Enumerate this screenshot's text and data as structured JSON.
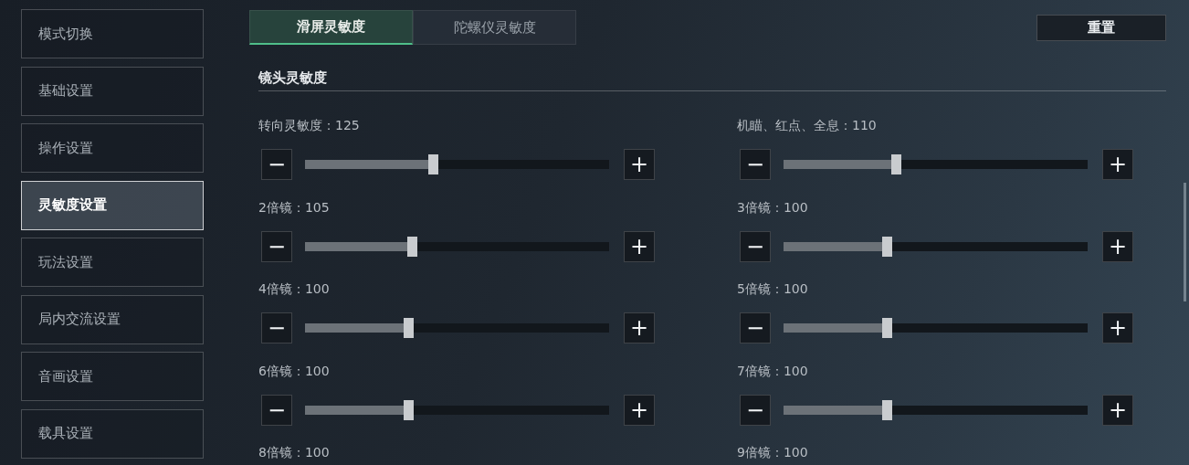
{
  "sidebar": {
    "items": [
      {
        "label": "模式切换",
        "selected": false
      },
      {
        "label": "基础设置",
        "selected": false
      },
      {
        "label": "操作设置",
        "selected": false
      },
      {
        "label": "灵敏度设置",
        "selected": true
      },
      {
        "label": "玩法设置",
        "selected": false
      },
      {
        "label": "局内交流设置",
        "selected": false
      },
      {
        "label": "音画设置",
        "selected": false
      },
      {
        "label": "载具设置",
        "selected": false
      }
    ]
  },
  "tabs": [
    {
      "label": "滑屏灵敏度",
      "selected": true
    },
    {
      "label": "陀螺仪灵敏度",
      "selected": false
    }
  ],
  "reset_button": "重置",
  "section_title": "镜头灵敏度",
  "sliders": [
    {
      "kind": "slider",
      "label": "转向灵敏度：125",
      "level": 0.42,
      "minus": "−",
      "plus": "+"
    },
    {
      "kind": "slider",
      "label": "机瞄、红点、全息：110",
      "level": 0.37,
      "minus": "−",
      "plus": "+"
    },
    {
      "kind": "slider",
      "label": "2倍镜：105",
      "level": 0.35,
      "minus": "−",
      "plus": "+"
    },
    {
      "kind": "slider",
      "label": "3倍镜：100",
      "level": 0.34,
      "minus": "−",
      "plus": "+"
    },
    {
      "kind": "slider",
      "label": "4倍镜：100",
      "level": 0.34,
      "minus": "−",
      "plus": "+"
    },
    {
      "kind": "slider",
      "label": "5倍镜：100",
      "level": 0.34,
      "minus": "−",
      "plus": "+"
    },
    {
      "kind": "slider",
      "label": "6倍镜：100",
      "level": 0.34,
      "minus": "−",
      "plus": "+"
    },
    {
      "kind": "slider",
      "label": "7倍镜：100",
      "level": 0.34,
      "minus": "−",
      "plus": "+"
    },
    {
      "kind": "label",
      "label": "8倍镜：100"
    },
    {
      "kind": "label",
      "label": "9倍镜：100"
    }
  ]
}
